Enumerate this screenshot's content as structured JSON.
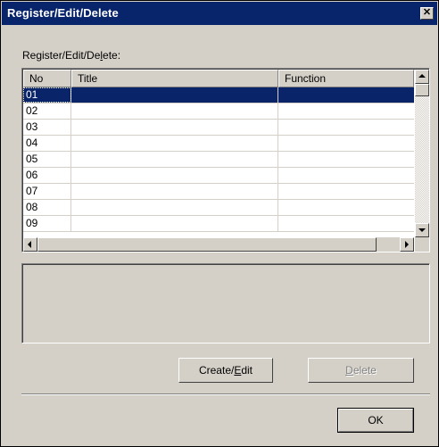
{
  "window": {
    "title": "Register/Edit/Delete",
    "close_glyph": "✕"
  },
  "group_label": {
    "pre": "Register/Edit/De",
    "accel": "l",
    "post": "ete:"
  },
  "list": {
    "columns": [
      "No",
      "Title",
      "Function"
    ],
    "rows": [
      {
        "no": "01",
        "title": "",
        "function": ""
      },
      {
        "no": "02",
        "title": "",
        "function": ""
      },
      {
        "no": "03",
        "title": "",
        "function": ""
      },
      {
        "no": "04",
        "title": "",
        "function": ""
      },
      {
        "no": "05",
        "title": "",
        "function": ""
      },
      {
        "no": "06",
        "title": "",
        "function": ""
      },
      {
        "no": "07",
        "title": "",
        "function": ""
      },
      {
        "no": "08",
        "title": "",
        "function": ""
      },
      {
        "no": "09",
        "title": "",
        "function": ""
      }
    ],
    "selected_row": "01"
  },
  "buttons": {
    "create_edit": {
      "pre": "Create/",
      "accel": "E",
      "post": "dit"
    },
    "delete": {
      "pre": "",
      "accel": "D",
      "post": "elete"
    },
    "ok": "OK"
  },
  "colors": {
    "face": "#d4d0c8",
    "title_bar": "#08246b",
    "selection": "#0a246a"
  },
  "icons": {
    "close": "close-icon",
    "up": "arrow-up-icon",
    "down": "arrow-down-icon",
    "left": "arrow-left-icon",
    "right": "arrow-right-icon"
  }
}
